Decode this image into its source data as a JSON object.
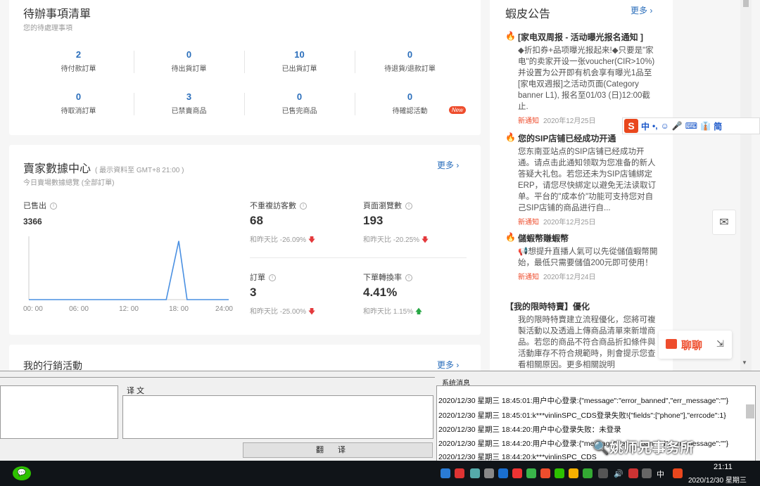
{
  "todo": {
    "title": "待辦事項清單",
    "subtitle": "您的待處理事項",
    "items": [
      {
        "value": "2",
        "label": "待付款訂單"
      },
      {
        "value": "0",
        "label": "待出貨訂單"
      },
      {
        "value": "10",
        "label": "已出貨訂單"
      },
      {
        "value": "0",
        "label": "待退貨/退款訂單"
      },
      {
        "value": "0",
        "label": "待取消訂單"
      },
      {
        "value": "3",
        "label": "已禁賣商品"
      },
      {
        "value": "0",
        "label": "已售完商品"
      },
      {
        "value": "0",
        "label": "待確認活動"
      }
    ],
    "new_badge": "New"
  },
  "data_center": {
    "title": "賣家數據中心",
    "note": "( 最示資料至 GMT+8 21:00 )",
    "subtitle": "今日賣場數據總覽 (全部訂單)",
    "more": "更多",
    "sold_label": "已售出",
    "sold_value": "3366",
    "metrics": [
      {
        "label": "不重複訪客數",
        "value": "68",
        "compare": "和昨天比 -26.09%",
        "trend": "down"
      },
      {
        "label": "頁面瀏覽數",
        "value": "193",
        "compare": "和昨天比 -20.25%",
        "trend": "down"
      },
      {
        "label": "訂單",
        "value": "3",
        "compare": "和昨天比 -25.00%",
        "trend": "down"
      },
      {
        "label": "下單轉換率",
        "value": "4.41%",
        "compare": "和昨天比 1.15%",
        "trend": "up"
      }
    ]
  },
  "chart_data": {
    "type": "line",
    "x_ticks": [
      "00: 00",
      "06: 00",
      "12: 00",
      "18: 00",
      "24:00"
    ],
    "xlim": [
      0,
      24
    ],
    "series": [
      {
        "x": [
          0,
          16.5,
          18,
          19,
          24
        ],
        "y": [
          0,
          0,
          1,
          0,
          0
        ]
      }
    ],
    "ylim": [
      0,
      1.08
    ],
    "color": "#4a90e2",
    "grid": false
  },
  "marketing": {
    "title": "我的行銷活動",
    "more": "更多"
  },
  "announcements": {
    "title": "蝦皮公告",
    "more": "更多",
    "items": [
      {
        "title": "[家电双周报 - 活动曝光报名通知 ]",
        "body": "◆折扣券+品项曝光报起来!◆只要是\"家电\"的卖家开设一张voucher(CIR>10%)并设置为公开即有机会享有曝光1品至 [家电双週报]之活动页面(Category banner L1), 报名至01/03 (日)12:00截止.",
        "tag": "新通知",
        "date": "2020年12月25日"
      },
      {
        "title": "您的SIP店铺已经成功开通",
        "body": "您东南亚站点的SIP店铺已经成功开通。请点击此通知领取为您准备的新人答疑大礼包。若您还未为SIP店铺綁定ERP，请您尽快綁定以避免无法读取订单。平台的\"成本价\"功能可支持您对自己SIP店铺的商品进行自...",
        "tag": "新通知",
        "date": "2020年12月25日"
      },
      {
        "title": "儲蝦幣賺蝦幣",
        "body": "📢想提升直播人氣可以先從儲值蝦幣開始，最低只需要儲值200元即可使用！",
        "tag": "新通知",
        "date": "2020年12月24日"
      },
      {
        "title": "【我的限時特賣】優化",
        "body": "我的限時特賣建立流程優化，您將可複製活動以及透過上傳商品清單來新增商品。若您的商品不符合商品折扣條件與活動庫存不符合規範時，則會提示您查看相關原因。更多相關說明"
      }
    ]
  },
  "ime": {
    "logo": "S",
    "items": [
      "中",
      "•,",
      "☺",
      "🎤",
      "⌨",
      "👔",
      "简"
    ]
  },
  "chat": {
    "label": "聊聊"
  },
  "translator": {
    "target_label": "译 文",
    "translate_button": "翻译",
    "sys_title": "系统消息",
    "messages": [
      "2020/12/30 星期三 18:45:01:用户中心登录:{\"message\":\"error_banned\",\"err_message\":\"\"}",
      "2020/12/30 星期三 18:45:01:k***vinlinSPC_CDS登录失败!{\"fields\":[\"phone\"],\"errcode\":1}",
      "2020/12/30 星期三 18:44:20:用户中心登录失败：未登录",
      "2020/12/30 星期三 18:44:20:用户中心登录:{\"message\":\"error_banned\",\"err_message\":\"\"}",
      "2020/12/30 星期三 18:44:20:k***vinlinSPC_CDS"
    ],
    "watermark": "🔍姚师兄事务所"
  },
  "taskbar": {
    "time": "21:11",
    "date": "2020/12/30 星期三",
    "ime_lang": "中"
  }
}
